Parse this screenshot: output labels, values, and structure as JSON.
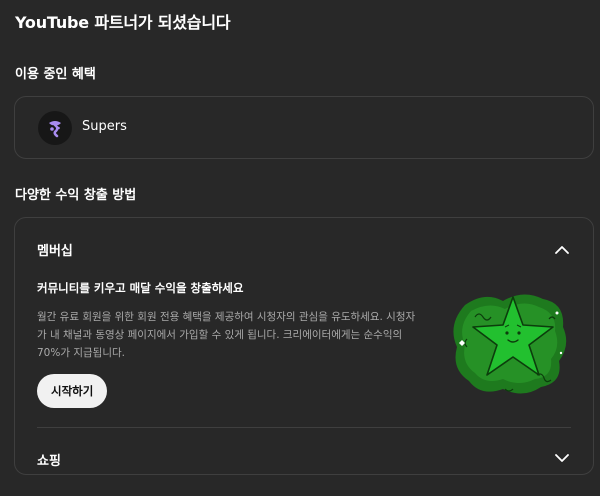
{
  "page": {
    "title": "YouTube 파트너가 되셨습니다"
  },
  "current_benefits": {
    "heading": "이용 중인 혜택",
    "items": [
      {
        "label": "Supers",
        "icon": "supers-icon"
      }
    ]
  },
  "methods": {
    "heading": "다양한 수익 창출 방법",
    "membership": {
      "title": "멤버십",
      "expanded": true,
      "heading": "커뮤니티를 키우고 매달 수익을 창출하세요",
      "description": "월간 유료 회원을 위한 회원 전용 혜택을 제공하여 시청자의 관심을 유도하세요. 시청자가 내 채널과 동영상 페이지에서 가입할 수 있게 됩니다. 크리에이터에게는 순수익의 70%가 지급됩니다.",
      "button_label": "시작하기",
      "illustration": "green-star-illustration"
    },
    "shopping": {
      "title": "쇼핑",
      "expanded": false
    }
  },
  "colors": {
    "background": "#282828",
    "border": "#3f3f3f",
    "star_green": "#22c02f",
    "supers_purple": "#a98cf0"
  }
}
